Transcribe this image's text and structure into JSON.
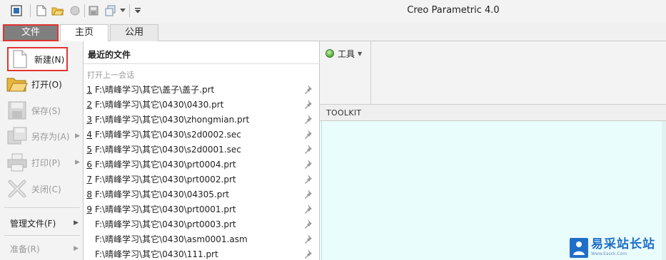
{
  "window": {
    "title": "Creo Parametric 4.0"
  },
  "ribbon_tabs": [
    {
      "label": "文件"
    },
    {
      "label": "主页"
    },
    {
      "label": "公用"
    }
  ],
  "file_menu": {
    "items": [
      {
        "label": "新建(N)",
        "icon": "new-file-icon",
        "enabled": true
      },
      {
        "label": "打开(O)",
        "icon": "folder-open-icon",
        "enabled": true
      },
      {
        "label": "保存(S)",
        "icon": "save-icon",
        "enabled": false
      },
      {
        "label": "另存为(A)",
        "icon": "save-as-icon",
        "enabled": false
      },
      {
        "label": "打印(P)",
        "icon": "print-icon",
        "enabled": false
      },
      {
        "label": "关闭(C)",
        "icon": "close-icon",
        "enabled": false
      }
    ],
    "sub_items": [
      {
        "label": "管理文件(F)"
      },
      {
        "label": "准备(R)"
      }
    ]
  },
  "recent_files": {
    "title": "最近的文件",
    "session_link": "打开上一会话",
    "files": [
      {
        "num": "1",
        "path": "F:\\晴峰学习\\其它\\盖子\\盖子.prt"
      },
      {
        "num": "2",
        "path": "F:\\晴峰学习\\其它\\0430\\0430.prt"
      },
      {
        "num": "3",
        "path": "F:\\晴峰学习\\其它\\0430\\zhongmian.prt"
      },
      {
        "num": "4",
        "path": "F:\\晴峰学习\\其它\\0430\\s2d0002.sec"
      },
      {
        "num": "5",
        "path": "F:\\晴峰学习\\其它\\0430\\s2d0001.sec"
      },
      {
        "num": "6",
        "path": "F:\\晴峰学习\\其它\\0430\\prt0004.prt"
      },
      {
        "num": "7",
        "path": "F:\\晴峰学习\\其它\\0430\\prt0002.prt"
      },
      {
        "num": "8",
        "path": "F:\\晴峰学习\\其它\\0430\\04305.prt"
      },
      {
        "num": "9",
        "path": "F:\\晴峰学习\\其它\\0430\\prt0001.prt"
      },
      {
        "num": "",
        "path": "F:\\晴峰学习\\其它\\0430\\prt0003.prt"
      },
      {
        "num": "",
        "path": "F:\\晴峰学习\\其它\\0430\\asm0001.asm"
      },
      {
        "num": "",
        "path": "F:\\晴峰学习\\其它\\0430\\111.prt"
      }
    ]
  },
  "right_panel": {
    "tools_label": "工具",
    "toolkit_label": "TOOLKIT"
  },
  "watermark": {
    "cn": "易采站长站",
    "en": "Www.Easck.Com"
  },
  "colors": {
    "highlight_border": "#e2342f",
    "file_tab_bg": "#7f7f7f",
    "canvas_bg": "#eafdfd",
    "watermark_blue": "#1f6fc9"
  }
}
